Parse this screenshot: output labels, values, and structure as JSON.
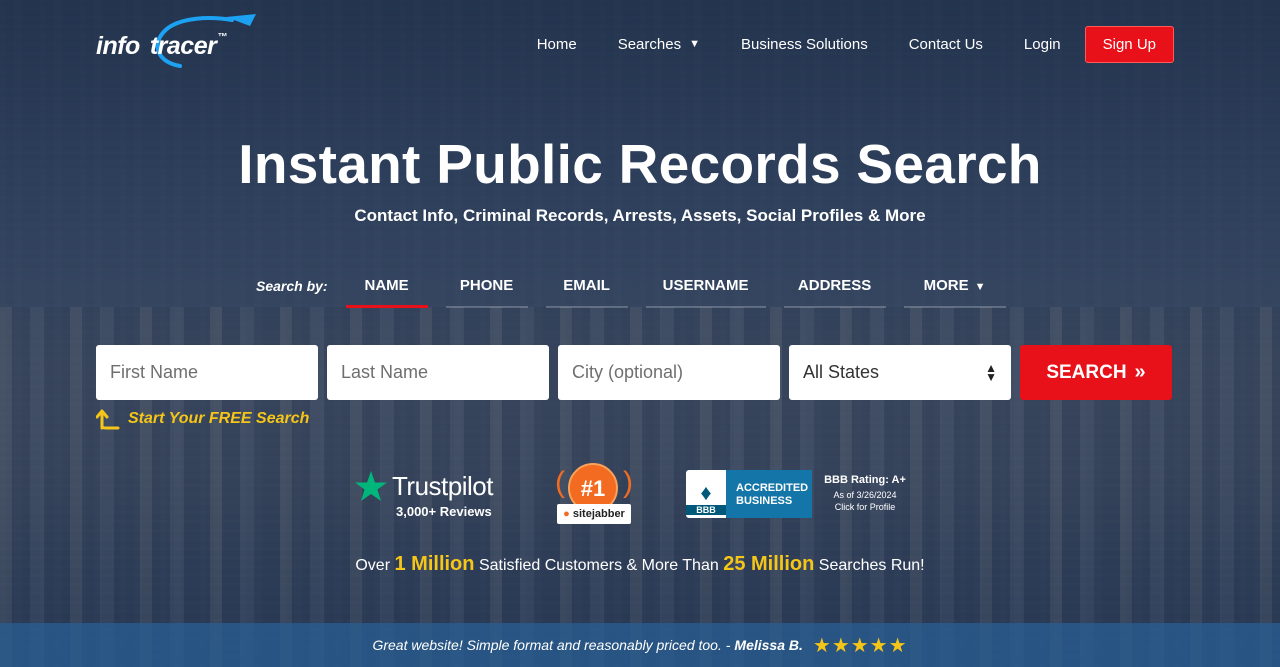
{
  "brand": {
    "part1": "info",
    "part2": "tracer",
    "tm": "™",
    "accent": "#1da1f2"
  },
  "nav": {
    "home": "Home",
    "searches": "Searches",
    "business": "Business Solutions",
    "contact": "Contact Us",
    "login": "Login",
    "signup": "Sign Up"
  },
  "hero": {
    "title": "Instant Public Records Search",
    "subtitle": "Contact Info, Criminal Records, Arrests, Assets, Social Profiles & More"
  },
  "search_tabs": {
    "label": "Search by:",
    "items": [
      "NAME",
      "PHONE",
      "EMAIL",
      "USERNAME",
      "ADDRESS",
      "MORE"
    ],
    "active": "NAME"
  },
  "search_form": {
    "first_name_placeholder": "First Name",
    "last_name_placeholder": "Last Name",
    "city_placeholder": "City (optional)",
    "state_selected": "All States",
    "search_label": "SEARCH",
    "search_icon": "double-chevron-right-icon",
    "free_search": "Start Your FREE Search"
  },
  "trust": {
    "trustpilot_name": "Trustpilot",
    "trustpilot_reviews": "3,000+ Reviews",
    "sitejabber_rank": "#1",
    "sitejabber_name": "sitejabber",
    "bbb_mark": "BBB",
    "bbb_accredited_line1": "ACCREDITED",
    "bbb_accredited_line2": "BUSINESS",
    "bbb_rating": "BBB Rating: A+",
    "bbb_date": "As of 3/26/2024",
    "bbb_click": "Click for Profile"
  },
  "stats": {
    "prefix": "Over",
    "customers": "1 Million",
    "middle": "Satisfied Customers & More Than",
    "searches": "25 Million",
    "suffix": "Searches Run!"
  },
  "testimonial": {
    "quote": "Great website! Simple format and reasonably priced too. -",
    "author": "Melissa B.",
    "stars": "★★★★★",
    "rating": 5
  },
  "colors": {
    "red": "#e8111a",
    "gold": "#f5c518",
    "trustpilot_green": "#00b67a",
    "sitejabber_orange": "#f26b21",
    "bbb_blue": "#1476a8"
  }
}
